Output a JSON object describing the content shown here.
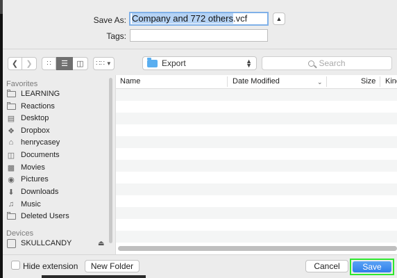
{
  "save_form": {
    "save_as_label": "Save As:",
    "filename_selected": "Company and 772 others",
    "filename_ext": ".vcf",
    "tags_label": "Tags:",
    "tags_value": ""
  },
  "toolbar": {
    "location": "Export",
    "search_placeholder": "Search"
  },
  "sidebar": {
    "favorites_header": "Favorites",
    "favorites": [
      {
        "label": "LEARNING",
        "icon": "folder-icon"
      },
      {
        "label": "Reactions",
        "icon": "folder-icon"
      },
      {
        "label": "Desktop",
        "icon": "desktop-icon"
      },
      {
        "label": "Dropbox",
        "icon": "dropbox-icon"
      },
      {
        "label": "henrycasey",
        "icon": "home-icon"
      },
      {
        "label": "Documents",
        "icon": "documents-icon"
      },
      {
        "label": "Movies",
        "icon": "movies-icon"
      },
      {
        "label": "Pictures",
        "icon": "pictures-icon"
      },
      {
        "label": "Downloads",
        "icon": "downloads-icon"
      },
      {
        "label": "Music",
        "icon": "music-icon"
      },
      {
        "label": "Deleted Users",
        "icon": "folder-icon"
      }
    ],
    "devices_header": "Devices",
    "devices": [
      {
        "label": "SKULLCANDY",
        "icon": "drive-icon"
      }
    ]
  },
  "file_list": {
    "columns": [
      "Name",
      "Date Modified",
      "Size",
      "Kind"
    ]
  },
  "bottom": {
    "hide_extension_label": "Hide extension",
    "new_folder_label": "New Folder",
    "cancel_label": "Cancel",
    "save_label": "Save"
  },
  "colors": {
    "accent": "#2f7fe9",
    "selection": "#b5d3f5",
    "highlight_frame": "#2ee82e"
  }
}
